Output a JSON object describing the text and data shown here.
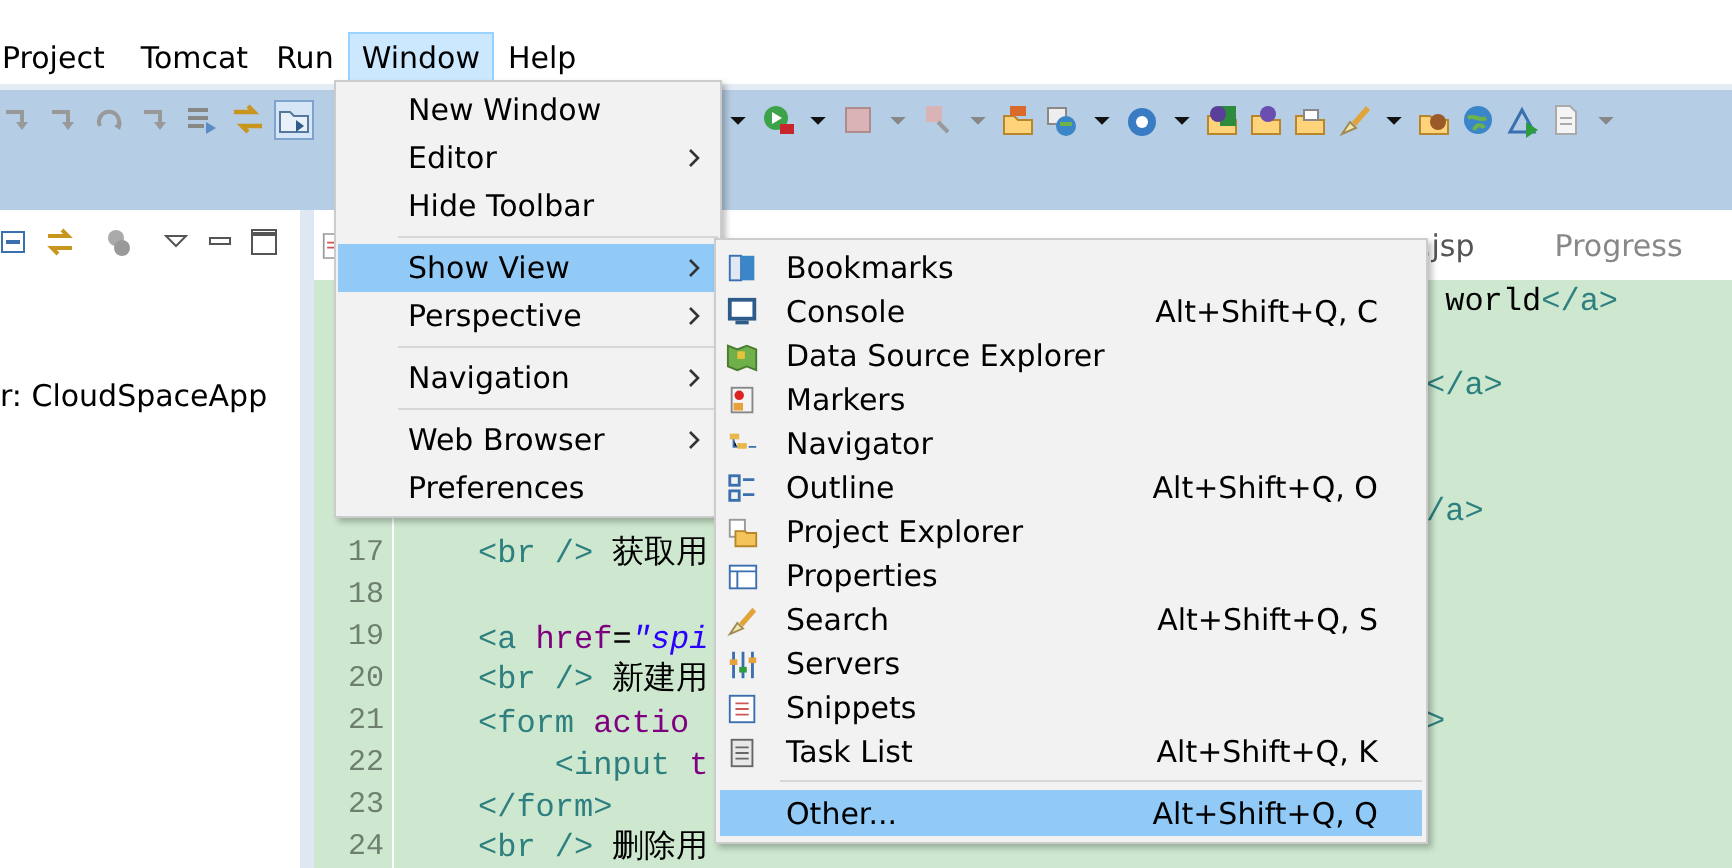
{
  "menubar": [
    {
      "label": "Project",
      "selected": false
    },
    {
      "label": "Tomcat",
      "selected": false
    },
    {
      "label": "Run",
      "selected": false
    },
    {
      "label": "Window",
      "selected": true
    },
    {
      "label": "Help",
      "selected": false
    }
  ],
  "left_panel": {
    "text": "r: CloudSpaceApp"
  },
  "editor": {
    "tabs": [
      {
        "label": ".jsp"
      },
      {
        "label": "Progress"
      }
    ],
    "lines": [
      {
        "kind": "code",
        "right": [
          {
            "kind": "text",
            "text": " world"
          },
          {
            "kind": "tag",
            "text": "</a>"
          }
        ]
      },
      {
        "kind": "blank"
      },
      {
        "kind": "code",
        "right": [
          {
            "kind": "tag",
            "text": "</a>"
          }
        ]
      },
      {
        "kind": "blank"
      },
      {
        "kind": "blank"
      },
      {
        "kind": "code",
        "right": [
          {
            "kind": "tag",
            "text": "/a>"
          }
        ]
      },
      {
        "number": "17",
        "code": [
          {
            "kind": "tag",
            "text": "<br />"
          },
          {
            "kind": "text",
            "text": " 获取用"
          }
        ]
      },
      {
        "number": "18"
      },
      {
        "number": "19",
        "code": [
          {
            "kind": "tag",
            "text": "<a"
          },
          {
            "kind": "attr",
            "text": " href"
          },
          {
            "kind": "text",
            "text": "="
          },
          {
            "kind": "string",
            "text": "\"spi"
          }
        ]
      },
      {
        "number": "20",
        "code": [
          {
            "kind": "tag",
            "text": "<br />"
          },
          {
            "kind": "text",
            "text": " 新建用"
          }
        ]
      },
      {
        "number": "21",
        "code": [
          {
            "kind": "tag",
            "text": "<form"
          },
          {
            "kind": "attr",
            "text": " actio"
          }
        ],
        "right": [
          {
            "kind": "tag",
            "text": ">"
          }
        ]
      },
      {
        "number": "22",
        "code": [
          {
            "kind": "tag",
            "text": "    <input"
          },
          {
            "kind": "attr",
            "text": " t"
          }
        ]
      },
      {
        "number": "23",
        "code": [
          {
            "kind": "tag",
            "text": "</form>"
          }
        ]
      },
      {
        "number": "24",
        "code": [
          {
            "kind": "tag",
            "text": "<br />"
          },
          {
            "kind": "text",
            "text": " 删除用"
          }
        ]
      }
    ]
  },
  "window_menu": {
    "groups": [
      [
        {
          "label": "New Window",
          "has_submenu": false,
          "selected": false
        },
        {
          "label": "Editor",
          "has_submenu": true,
          "selected": false
        },
        {
          "label": "Hide Toolbar",
          "has_submenu": false,
          "selected": false
        }
      ],
      [
        {
          "label": "Show View",
          "has_submenu": true,
          "selected": true
        },
        {
          "label": "Perspective",
          "has_submenu": true,
          "selected": false
        }
      ],
      [
        {
          "label": "Navigation",
          "has_submenu": true,
          "selected": false
        }
      ],
      [
        {
          "label": "Web Browser",
          "has_submenu": true,
          "selected": false
        },
        {
          "label": "Preferences",
          "has_submenu": false,
          "selected": false
        }
      ]
    ]
  },
  "show_view_menu": {
    "groups": [
      [
        {
          "label": "Bookmarks",
          "selected": false
        },
        {
          "label": "Console",
          "shortcut": "Alt+Shift+Q, C",
          "selected": false
        },
        {
          "label": "Data Source Explorer",
          "selected": false
        },
        {
          "label": "Markers",
          "selected": false
        },
        {
          "label": "Navigator",
          "selected": false
        },
        {
          "label": "Outline",
          "shortcut": "Alt+Shift+Q, O",
          "selected": false
        },
        {
          "label": "Project Explorer",
          "selected": false
        },
        {
          "label": "Properties",
          "selected": false
        },
        {
          "label": "Search",
          "shortcut": "Alt+Shift+Q, S",
          "selected": false
        },
        {
          "label": "Servers",
          "selected": false
        },
        {
          "label": "Snippets",
          "selected": false
        },
        {
          "label": "Task List",
          "shortcut": "Alt+Shift+Q, K",
          "selected": false
        }
      ],
      [
        {
          "label": "Other...",
          "shortcut": "Alt+Shift+Q, Q",
          "selected": true
        }
      ]
    ]
  }
}
